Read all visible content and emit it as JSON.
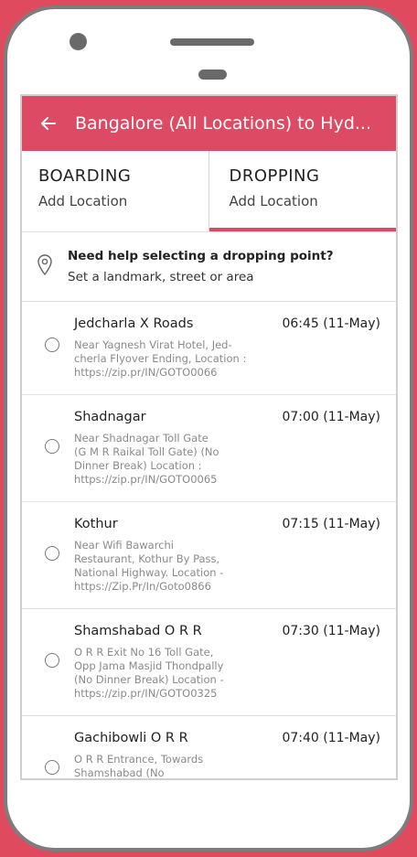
{
  "header": {
    "back_icon": "arrow-left-icon",
    "title": "Bangalore (All Locations) to Hyd..."
  },
  "tabs": {
    "boarding": {
      "title": "BOARDING",
      "sub": "Add Location"
    },
    "dropping": {
      "title": "DROPPING",
      "sub": "Add Location"
    }
  },
  "help": {
    "icon": "map-pin-icon",
    "title": "Need help selecting a dropping point?",
    "subtitle": "Set a landmark, street or area"
  },
  "stops": [
    {
      "name": "Jedcharla X Roads",
      "time": "06:45 (11-May)",
      "desc": [
        "Near Yagnesh Virat Hotel, Jed-",
        "cherla Flyover Ending, Location :",
        "https://zip.pr/IN/GOTO0066"
      ]
    },
    {
      "name": "Shadnagar",
      "time": "07:00 (11-May)",
      "desc": [
        "Near Shadnagar Toll Gate",
        "(G M R Raikal Toll Gate) (No",
        "Dinner Break) Location :",
        "https://zip.pr/IN/GOTO0065"
      ]
    },
    {
      "name": "Kothur",
      "time": "07:15 (11-May)",
      "desc": [
        "Near Wifi Bawarchi",
        "Restaurant, Kothur By Pass,",
        "National Highway. Location -",
        "https://Zip.Pr/In/Goto0866"
      ]
    },
    {
      "name": "Shamshabad O R R",
      "time": "07:30 (11-May)",
      "desc": [
        "O R R Exit No 16 Toll Gate,",
        "Opp Jama Masjid Thondpally",
        "(No Dinner Break) Location -",
        "https://zip.pr/IN/GOTO0325"
      ]
    },
    {
      "name": "Gachibowli O R R",
      "time": "07:40 (11-May)",
      "desc": [
        "O R R Entrance, Towards",
        "Shamshabad (No"
      ]
    }
  ],
  "colors": {
    "accent": "#dc4b63",
    "background": "#e04a5f"
  }
}
